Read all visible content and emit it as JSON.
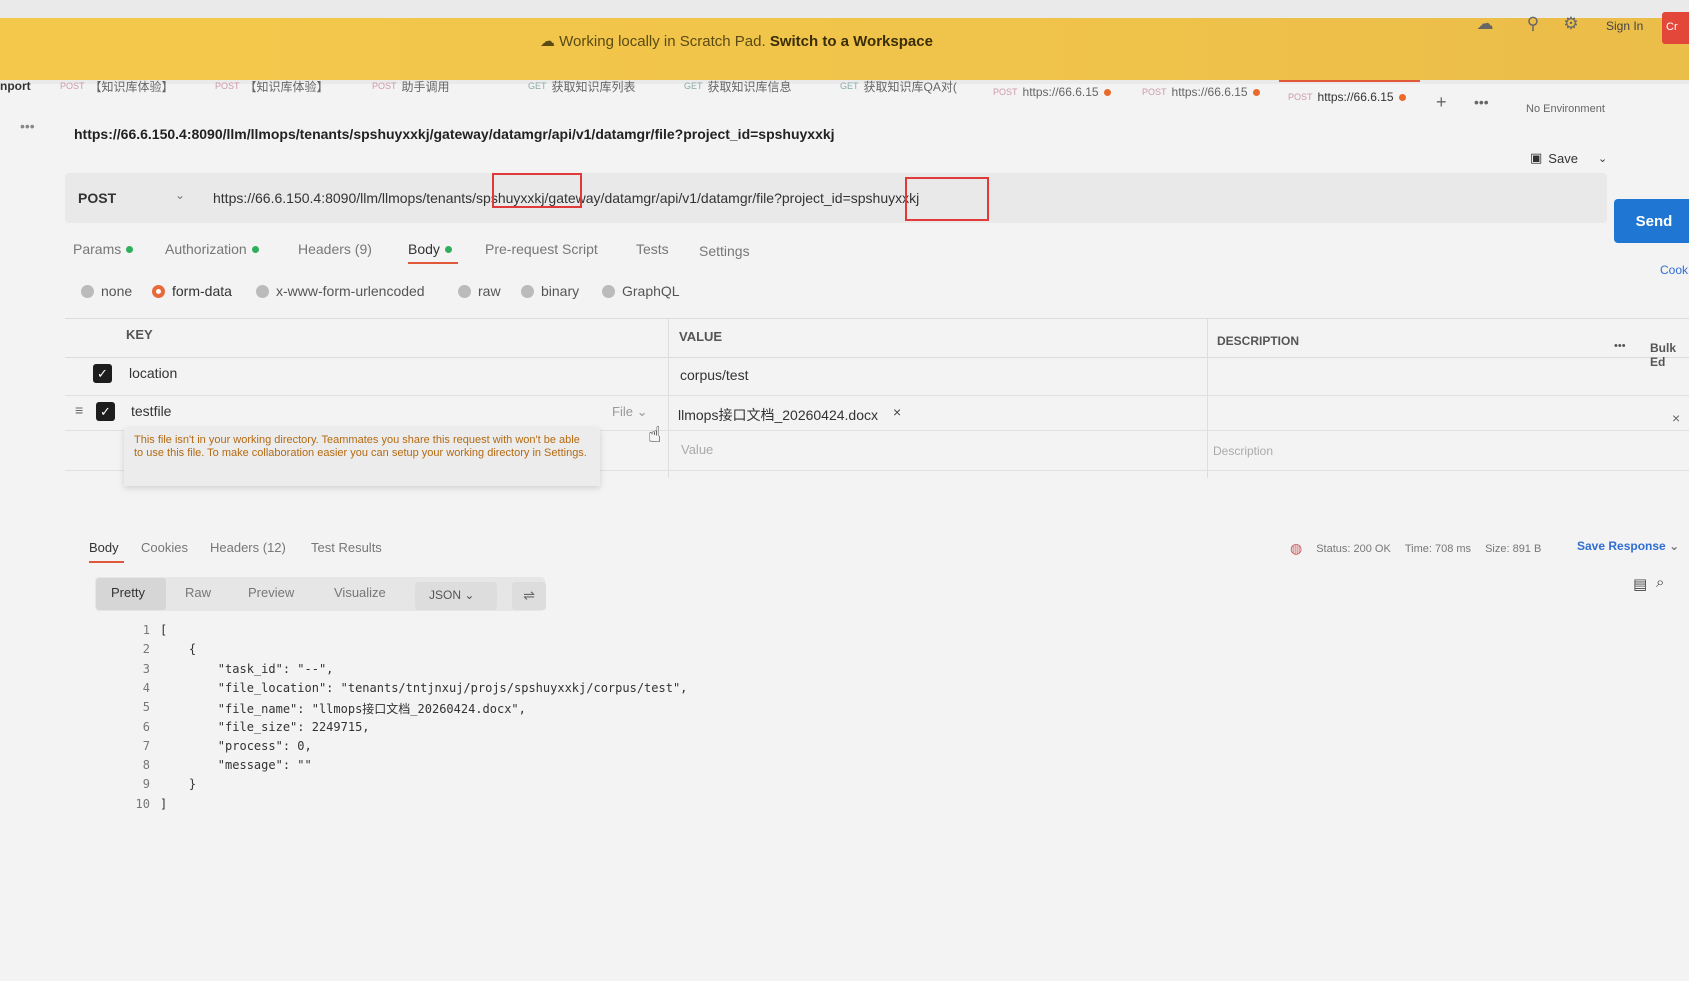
{
  "banner": {
    "text": "Working locally in Scratch Pad.",
    "link": "Switch to a Workspace"
  },
  "topbar": {
    "sign_in": "Sign In",
    "create": "Cr"
  },
  "tabs": [
    {
      "method": "",
      "label": "nport"
    },
    {
      "method": "POST",
      "label": "【知识库体验】"
    },
    {
      "method": "POST",
      "label": "【知识库体验】"
    },
    {
      "method": "POST",
      "label": "助手调用"
    },
    {
      "method": "GET",
      "label": "获取知识库列表"
    },
    {
      "method": "GET",
      "label": "获取知识库信息"
    },
    {
      "method": "GET",
      "label": "获取知识库QA对("
    },
    {
      "method": "POST",
      "label": "https://66.6.15"
    },
    {
      "method": "POST",
      "label": "https://66.6.15"
    },
    {
      "method": "POST",
      "label": "https://66.6.15"
    }
  ],
  "environment": "No Environment",
  "request": {
    "title_url": "https://66.6.150.4:8090/llm/llmops/tenants/spshuyxxkj/gateway/datamgr/api/v1/datamgr/file?project_id=spshuyxxkj",
    "method": "POST",
    "url": "https://66.6.150.4:8090/llm/llmops/tenants/spshuyxxkj/gateway/datamgr/api/v1/datamgr/file?project_id=spshuyxxkj",
    "save_label": "Save",
    "send_label": "Send",
    "cookies_label": "Cook"
  },
  "request_tabs": [
    {
      "label": "Params",
      "dot": true
    },
    {
      "label": "Authorization",
      "dot": true
    },
    {
      "label": "Headers (9)",
      "dot": false
    },
    {
      "label": "Body",
      "dot": true
    },
    {
      "label": "Pre-request Script",
      "dot": false
    },
    {
      "label": "Tests",
      "dot": false
    },
    {
      "label": "Settings",
      "dot": false
    }
  ],
  "body_types": [
    "none",
    "form-data",
    "x-www-form-urlencoded",
    "raw",
    "binary",
    "GraphQL"
  ],
  "selected_body_type": "form-data",
  "table": {
    "headers": {
      "key": "KEY",
      "value": "VALUE",
      "description": "DESCRIPTION",
      "bulk": "Bulk Ed"
    },
    "rows": [
      {
        "key": "location",
        "value": "corpus/test"
      },
      {
        "key": "testfile",
        "type": "File",
        "value": "llmops接口文档_20260424.docx"
      }
    ],
    "placeholder_value": "Value",
    "placeholder_description": "Description",
    "warning": "This file isn't in your working directory. Teammates you share this request with won't be able to use this file. To make collaboration easier you can setup your working directory in Settings."
  },
  "response": {
    "tabs": [
      "Body",
      "Cookies",
      "Headers (12)",
      "Test Results"
    ],
    "status": "Status: 200 OK",
    "time": "Time: 708 ms",
    "size": "Size: 891 B",
    "save_response": "Save Response",
    "view_tabs": [
      "Pretty",
      "Raw",
      "Preview",
      "Visualize"
    ],
    "format": "JSON",
    "code_lines": [
      {
        "n": "1",
        "text": "["
      },
      {
        "n": "2",
        "text": "    {"
      },
      {
        "n": "3",
        "text": "        \"task_id\": \"--\","
      },
      {
        "n": "4",
        "text": "        \"file_location\": \"tenants/tntjnxuj/projs/spshuyxxkj/corpus/test\","
      },
      {
        "n": "5",
        "text": "        \"file_name\": \"llmops接口文档_20260424.docx\","
      },
      {
        "n": "6",
        "text": "        \"file_size\": 2249715,"
      },
      {
        "n": "7",
        "text": "        \"process\": 0,"
      },
      {
        "n": "8",
        "text": "        \"message\": \"\""
      },
      {
        "n": "9",
        "text": "    }"
      },
      {
        "n": "10",
        "text": "]"
      }
    ]
  }
}
